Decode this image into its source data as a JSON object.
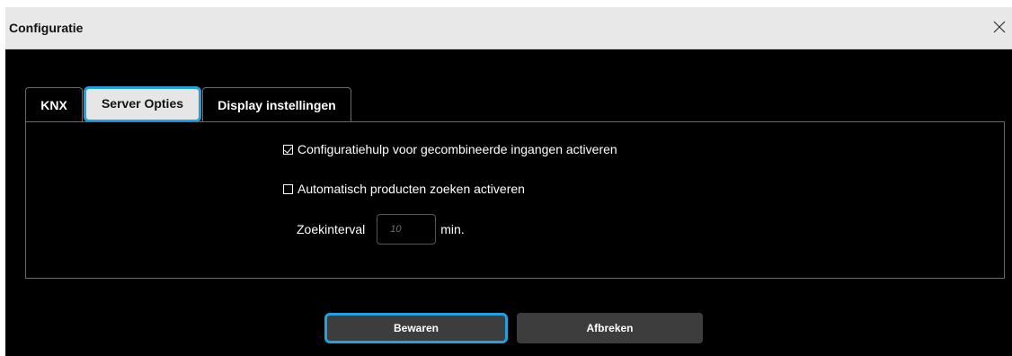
{
  "window": {
    "title": "Configuratie",
    "close_icon": "close-icon"
  },
  "tabs": [
    {
      "label": "KNX",
      "active": false
    },
    {
      "label": "Server Opties",
      "active": true
    },
    {
      "label": "Display instellingen",
      "active": false
    }
  ],
  "options": {
    "combined_inputs": {
      "label": "Configuratiehulp voor gecombineerde ingangen activeren",
      "checked": true
    },
    "auto_search": {
      "label": "Automatisch producten zoeken activeren",
      "checked": false
    },
    "interval": {
      "label": "Zoekinterval",
      "placeholder": "10",
      "value": "",
      "unit": "min."
    }
  },
  "buttons": {
    "save": "Bewaren",
    "cancel": "Afbreken"
  },
  "colors": {
    "accent": "#1fa3e0",
    "background": "#000000",
    "titlebar": "#e8e8e8",
    "button": "#3d3d3d"
  }
}
